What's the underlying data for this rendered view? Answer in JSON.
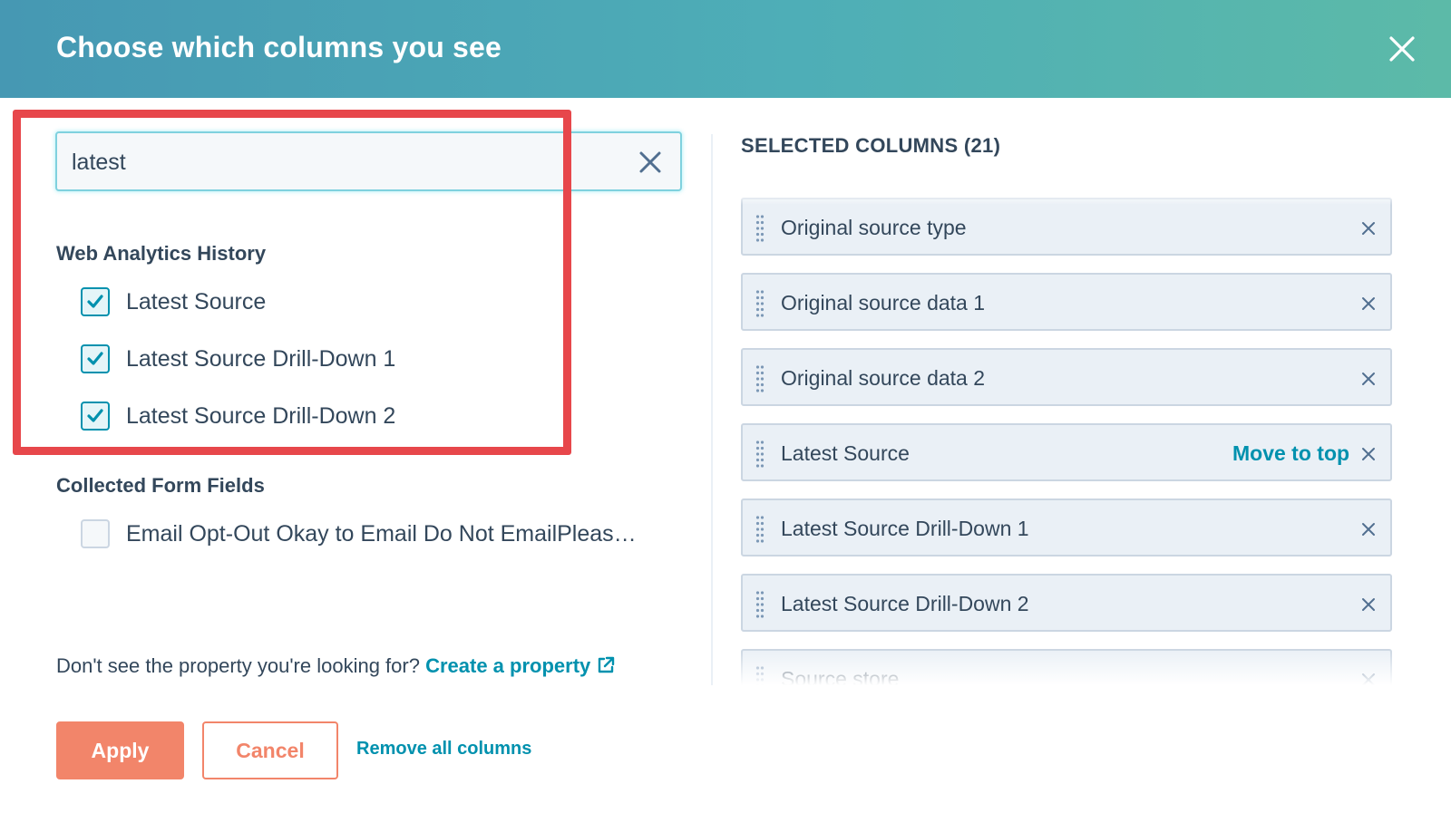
{
  "modal": {
    "title": "Choose which columns you see"
  },
  "search": {
    "value": "latest",
    "placeholder": "Search"
  },
  "groups": [
    {
      "title": "Web Analytics History",
      "options": [
        {
          "label": "Latest Source",
          "checked": true
        },
        {
          "label": "Latest Source Drill-Down 1",
          "checked": true
        },
        {
          "label": "Latest Source Drill-Down 2",
          "checked": true
        }
      ]
    },
    {
      "title": "Collected Form Fields",
      "options": [
        {
          "label": "Email Opt-Out Okay to Email Do Not EmailPleas…",
          "checked": false
        }
      ]
    }
  ],
  "helper": {
    "text": "Don't see the property you're looking for? ",
    "link": "Create a property"
  },
  "selected": {
    "title": "SELECTED COLUMNS (21)",
    "move_to_top_label": "Move to top",
    "items": [
      {
        "label": "Original source type"
      },
      {
        "label": "Original source data 1"
      },
      {
        "label": "Original source data 2"
      },
      {
        "label": "Latest Source"
      },
      {
        "label": "Latest Source Drill-Down 1"
      },
      {
        "label": "Latest Source Drill-Down 2"
      },
      {
        "label": "Source store"
      }
    ]
  },
  "footer": {
    "apply": "Apply",
    "cancel": "Cancel",
    "remove_all": "Remove all columns"
  },
  "colors": {
    "accent": "#0091ae",
    "primary_button": "#f2856a",
    "highlight": "#e7474b"
  }
}
